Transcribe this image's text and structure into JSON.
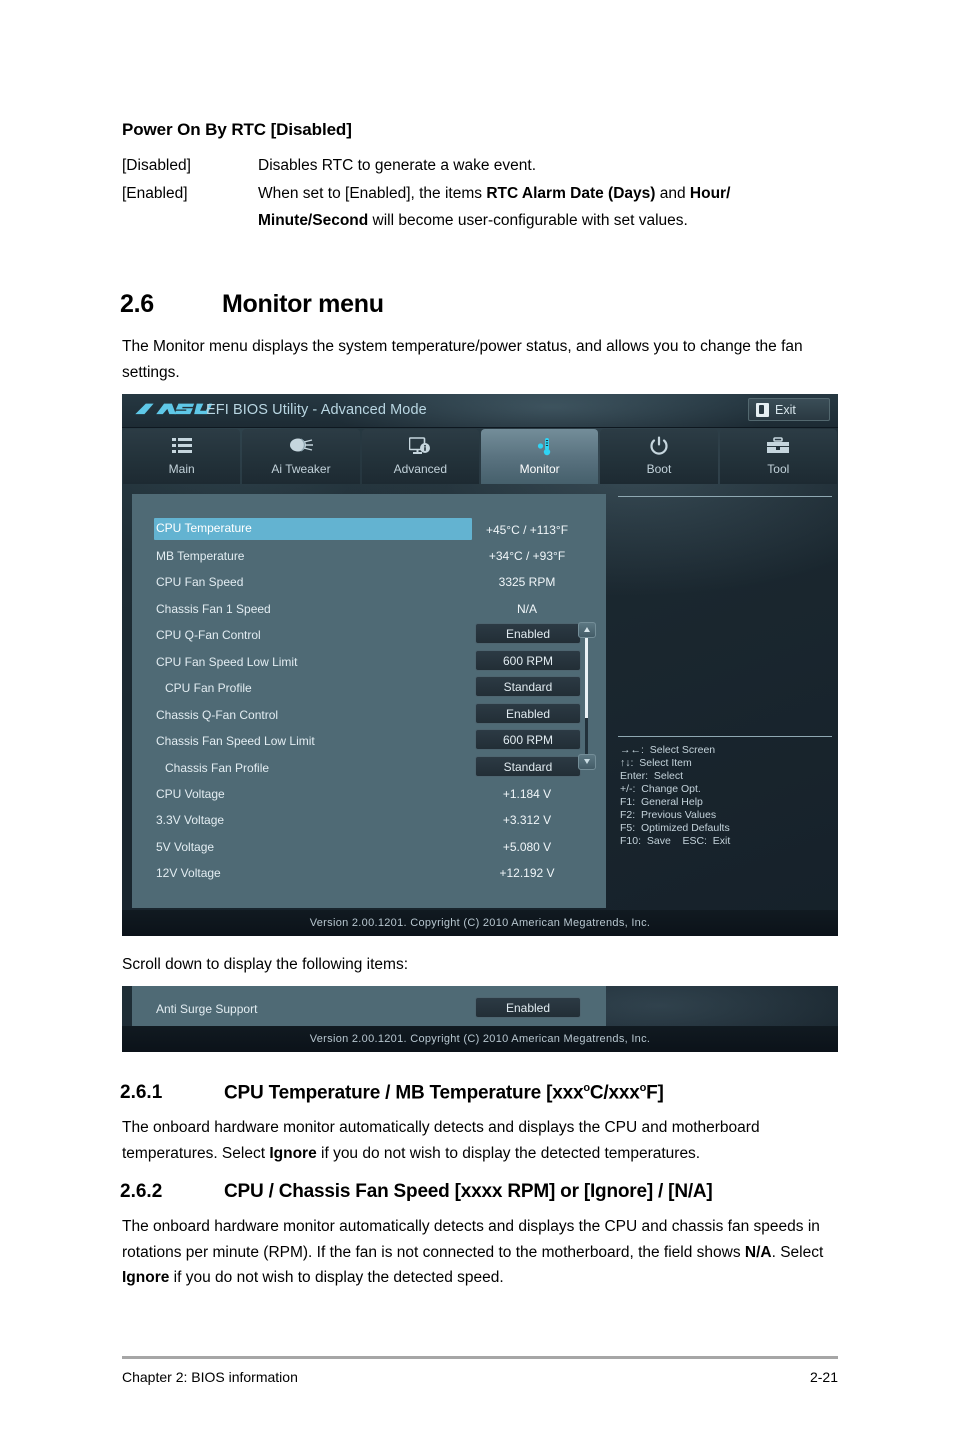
{
  "doc": {
    "heading1": "Power On By RTC [Disabled]",
    "options": [
      {
        "term": "[Disabled]",
        "def_plain": "Disables RTC to generate a wake event."
      },
      {
        "term": "[Enabled]",
        "def_plain": "When set to [Enabled], the items RTC Alarm Date (Days) and Hour/ Minute/Second will become user-configurable with set values."
      }
    ],
    "section": {
      "number": "2.6",
      "title": "Monitor menu",
      "intro": "The Monitor menu displays the system temperature/power status, and allows you to change the fan settings."
    },
    "scroll_note": "Scroll down to display the following items:",
    "subsections": [
      {
        "number": "2.6.1",
        "title": "CPU Temperature / MB Temperature [xxxoC/xxxoF]",
        "body": "The onboard hardware monitor automatically detects and displays the CPU and motherboard temperatures. Select Ignore if you do not wish to display the detected temperatures."
      },
      {
        "number": "2.6.2",
        "title": "CPU / Chassis Fan Speed [xxxx RPM] or [Ignore] / [N/A]",
        "body": "The onboard hardware monitor automatically detects and displays the CPU and chassis fan speeds in rotations per minute (RPM). If the fan is not connected to the motherboard, the field shows N/A. Select Ignore if you do not wish to display the detected speed."
      }
    ],
    "footer": {
      "left": "Chapter 2: BIOS information",
      "right": "2-21"
    }
  },
  "bios": {
    "brand": "ASUS",
    "title": "EFI BIOS Utility - Advanced Mode",
    "exit_label": "Exit",
    "tabs": [
      {
        "label": "Main",
        "icon": "list-icon",
        "active": false
      },
      {
        "label": "Ai  Tweaker",
        "icon": "tuning-knob-icon",
        "active": false
      },
      {
        "label": "Advanced",
        "icon": "monitor-info-icon",
        "active": false
      },
      {
        "label": "Monitor",
        "icon": "thermometer-fan-icon",
        "active": true
      },
      {
        "label": "Boot",
        "icon": "power-icon",
        "active": false
      },
      {
        "label": "Tool",
        "icon": "toolbox-icon",
        "active": false
      }
    ],
    "items": [
      {
        "label": "CPU Temperature",
        "value": "+45°C / +113°F",
        "type": "text",
        "selected": true,
        "indent": false
      },
      {
        "label": "MB Temperature",
        "value": "+34°C / +93°F",
        "type": "text",
        "selected": false,
        "indent": false
      },
      {
        "label": "CPU Fan Speed",
        "value": "3325 RPM",
        "type": "text",
        "selected": false,
        "indent": false
      },
      {
        "label": "Chassis Fan 1 Speed",
        "value": "N/A",
        "type": "text",
        "selected": false,
        "indent": false
      },
      {
        "label": "CPU Q-Fan Control",
        "value": "Enabled",
        "type": "option",
        "selected": false,
        "indent": false
      },
      {
        "label": "CPU Fan Speed Low Limit",
        "value": "600 RPM",
        "type": "option",
        "selected": false,
        "indent": false
      },
      {
        "label": "CPU Fan Profile",
        "value": "Standard",
        "type": "option",
        "selected": false,
        "indent": true
      },
      {
        "label": "Chassis Q-Fan Control",
        "value": "Enabled",
        "type": "option",
        "selected": false,
        "indent": false
      },
      {
        "label": "Chassis Fan Speed Low Limit",
        "value": "600 RPM",
        "type": "option",
        "selected": false,
        "indent": false
      },
      {
        "label": "Chassis Fan Profile",
        "value": "Standard",
        "type": "option",
        "selected": false,
        "indent": true
      },
      {
        "label": "CPU Voltage",
        "value": "+1.184 V",
        "type": "text",
        "selected": false,
        "indent": false
      },
      {
        "label": "3.3V Voltage",
        "value": "+3.312 V",
        "type": "text",
        "selected": false,
        "indent": false
      },
      {
        "label": "5V Voltage",
        "value": "+5.080 V",
        "type": "text",
        "selected": false,
        "indent": false
      },
      {
        "label": "12V Voltage",
        "value": "+12.192 V",
        "type": "text",
        "selected": false,
        "indent": false
      }
    ],
    "keylegend": "→←:  Select Screen\n↑↓:  Select Item\nEnter:  Select\n+/-:  Change Opt.\nF1:  General Help\nF2:  Previous Values\nF5:  Optimized Defaults\nF10:  Save    ESC:  Exit",
    "version": "Version  2.00.1201.   Copyright  (C)  2010  American  Megatrends,  Inc."
  },
  "bios2": {
    "item": {
      "label": "Anti Surge Support",
      "value": "Enabled"
    },
    "version": "Version  2.00.1201.   Copyright  (C)  2010  American  Megatrends,  Inc."
  },
  "colors": {
    "highlight": "#63b3d1",
    "pane": "#4f6a75",
    "accent_title": "#b9d6e2",
    "asus_logo": "#5fc8e8"
  }
}
